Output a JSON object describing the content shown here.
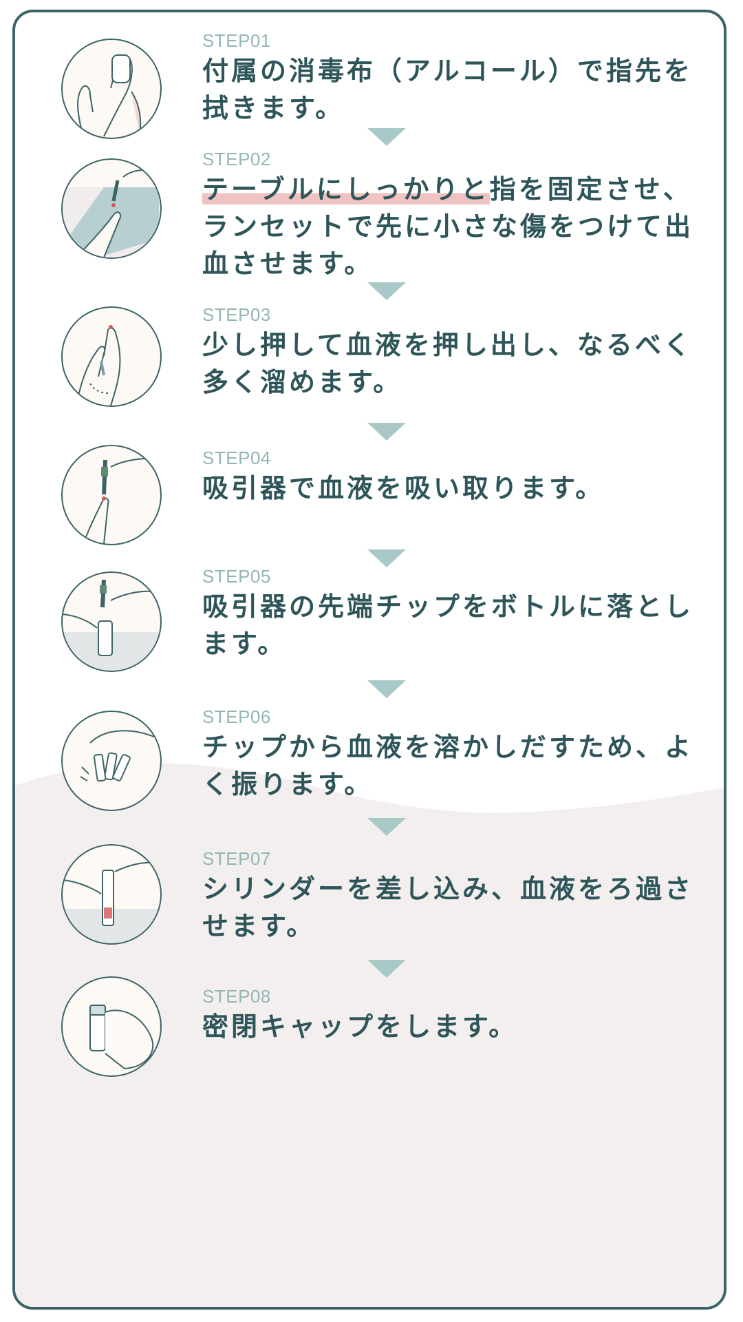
{
  "steps": [
    {
      "label": "STEP01",
      "text": "付属の消毒布（アルコール）で指先を拭きます。",
      "icon": "hand-wipe-icon"
    },
    {
      "label": "STEP02",
      "highlight": "テーブルにしっかりと",
      "text": "指を固定させ、ランセットで先に小さな傷をつけて出血させます。",
      "icon": "lancet-finger-icon"
    },
    {
      "label": "STEP03",
      "text": "少し押して血液を押し出し、なるべく多く溜めます。",
      "icon": "finger-squeeze-icon"
    },
    {
      "label": "STEP04",
      "text": "吸引器で血液を吸い取ります。",
      "icon": "aspirator-draw-icon"
    },
    {
      "label": "STEP05",
      "text": "吸引器の先端チップをボトルに落とします。",
      "icon": "tip-drop-bottle-icon"
    },
    {
      "label": "STEP06",
      "text": "チップから血液を溶かしだすため、よく振ります。",
      "icon": "shake-bottle-icon"
    },
    {
      "label": "STEP07",
      "text": "シリンダーを差し込み、血液をろ過させます。",
      "icon": "cylinder-insert-icon"
    },
    {
      "label": "STEP08",
      "text": "密閉キャップをします。",
      "icon": "cap-close-icon"
    }
  ],
  "colors": {
    "border": "#3c6367",
    "text": "#2e5559",
    "step_label": "#93b6b5",
    "arrow": "#a9c9c9",
    "highlight": "#f1c2c2",
    "background_wave": "#f4efef"
  }
}
